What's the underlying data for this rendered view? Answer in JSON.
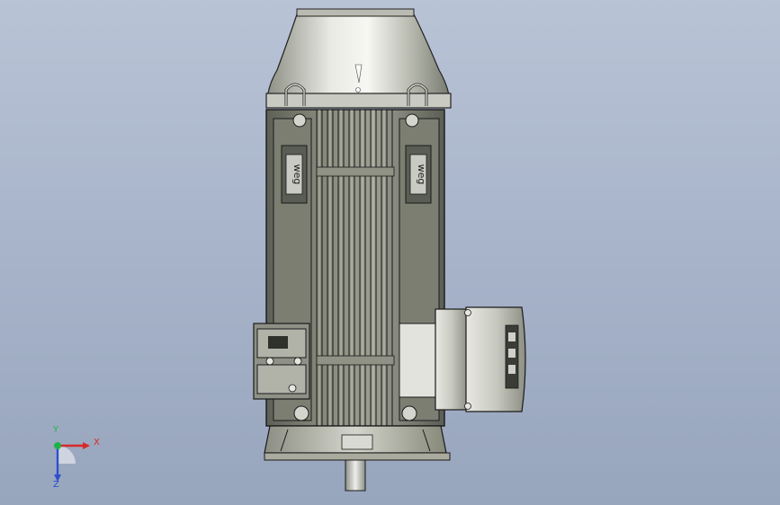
{
  "viewport": {
    "background_top": "#b9c3d6",
    "background_bottom": "#97a5bd"
  },
  "model": {
    "nameplate_text": "weg",
    "body_color": "#6c6f64",
    "cap_color": "#c7c8c0",
    "edge_color": "#1a1a1a"
  },
  "triad": {
    "x_label": "X",
    "y_label": "Y",
    "z_label": "Z",
    "x_color": "#d8282a",
    "y_color": "#1fb24a",
    "z_color": "#2c4fd0"
  }
}
